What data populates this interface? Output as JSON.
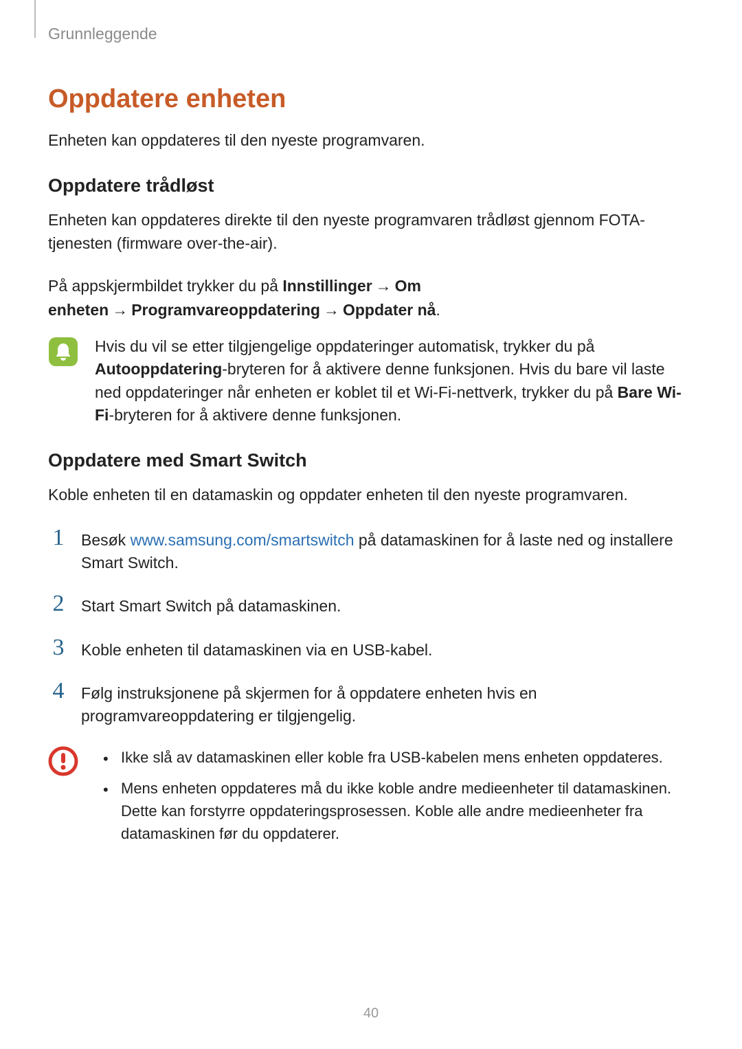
{
  "breadcrumb": "Grunnleggende",
  "h1": "Oppdatere enheten",
  "intro": "Enheten kan oppdateres til den nyeste programvaren.",
  "section1": {
    "heading": "Oppdatere trådløst",
    "p1": "Enheten kan oppdateres direkte til den nyeste programvaren trådløst gjennom FOTA-tjenesten (firmware over-the-air).",
    "p2_pre": "På appskjermbildet trykker du på ",
    "p2_b1": "Innstillinger",
    "p2_b2": "Om enheten",
    "p2_b3": "Programvareoppdatering",
    "p2_b4": "Oppdater nå",
    "arrow": "→",
    "period": ".",
    "note_pre": "Hvis du vil se etter tilgjengelige oppdateringer automatisk, trykker du på ",
    "note_b1": "Autooppdatering",
    "note_mid1": "-bryteren for å aktivere denne funksjonen. Hvis du bare vil laste ned oppdateringer når enheten er koblet til et Wi-Fi-nettverk, trykker du på ",
    "note_b2": "Bare Wi-Fi",
    "note_post": "-bryteren for å aktivere denne funksjonen."
  },
  "section2": {
    "heading": "Oppdatere med Smart Switch",
    "p1": "Koble enheten til en datamaskin og oppdater enheten til den nyeste programvaren.",
    "steps": {
      "n1": "1",
      "n2": "2",
      "n3": "3",
      "n4": "4",
      "s1_pre": "Besøk ",
      "s1_link": "www.samsung.com/smartswitch",
      "s1_post": " på datamaskinen for å laste ned og installere Smart Switch.",
      "s2": "Start Smart Switch på datamaskinen.",
      "s3": "Koble enheten til datamaskinen via en USB-kabel.",
      "s4": "Følg instruksjonene på skjermen for å oppdatere enheten hvis en programvareoppdatering er tilgjengelig."
    },
    "warnings": {
      "w1": "Ikke slå av datamaskinen eller koble fra USB-kabelen mens enheten oppdateres.",
      "w2": "Mens enheten oppdateres må du ikke koble andre medieenheter til datamaskinen. Dette kan forstyrre oppdateringsprosessen. Koble alle andre medieenheter fra datamaskinen før du oppdaterer."
    }
  },
  "bullet": "•",
  "page_number": "40"
}
